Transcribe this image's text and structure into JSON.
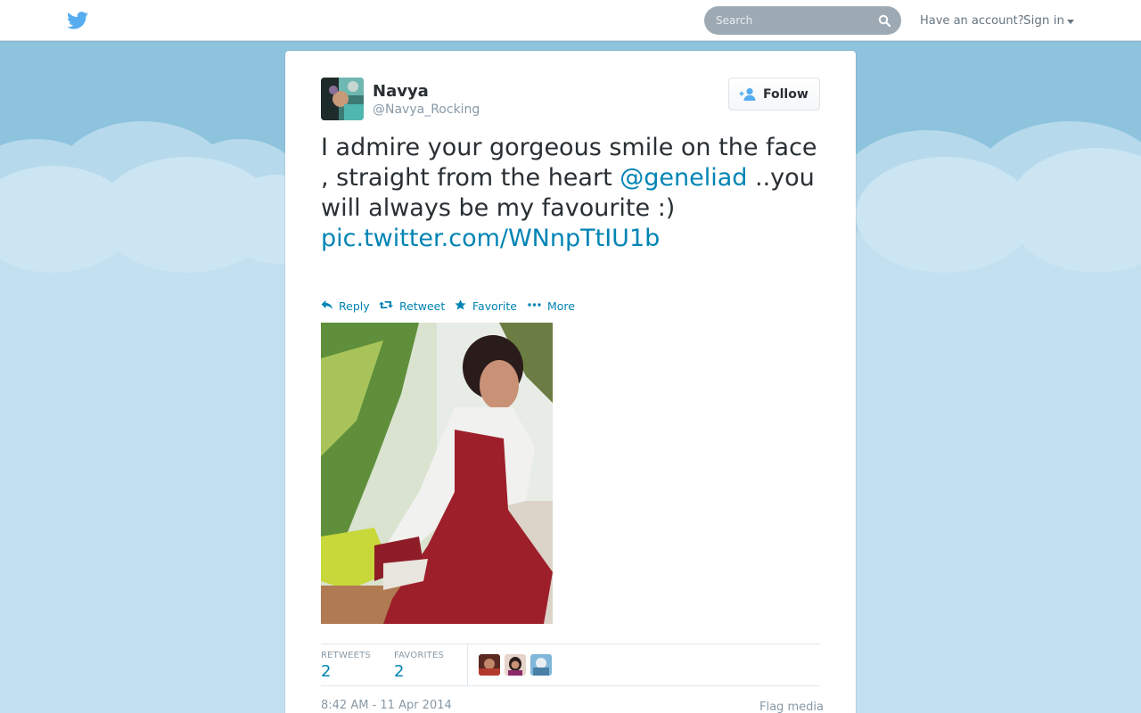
{
  "header": {
    "logo_icon": "twitter-bird-icon",
    "search_placeholder": "Search",
    "search_icon": "magnifier-icon",
    "have_account": "Have an account?",
    "sign_in": "Sign in",
    "brand_color": "#55acee"
  },
  "tweet": {
    "author_name": "Navya",
    "author_handle": "@Navya_Rocking",
    "follow_label": "Follow",
    "text_before_mention": "I admire your gorgeous smile on the face , straight from the heart ",
    "mention": "@geneliad",
    "text_after_mention": " ..you will always be my favourite :) ",
    "media_link": "pic.twitter.com/WNnpTtIU1b",
    "actions": {
      "reply": "Reply",
      "retweet": "Retweet",
      "favorite": "Favorite",
      "more": "More"
    },
    "stats": {
      "retweets_label": "RETWEETS",
      "retweets_value": "2",
      "favorites_label": "FAVORITES",
      "favorites_value": "2"
    },
    "timestamp": "8:42 AM - 11 Apr 2014",
    "flag_media": "Flag media",
    "link_color": "#0084b4"
  }
}
